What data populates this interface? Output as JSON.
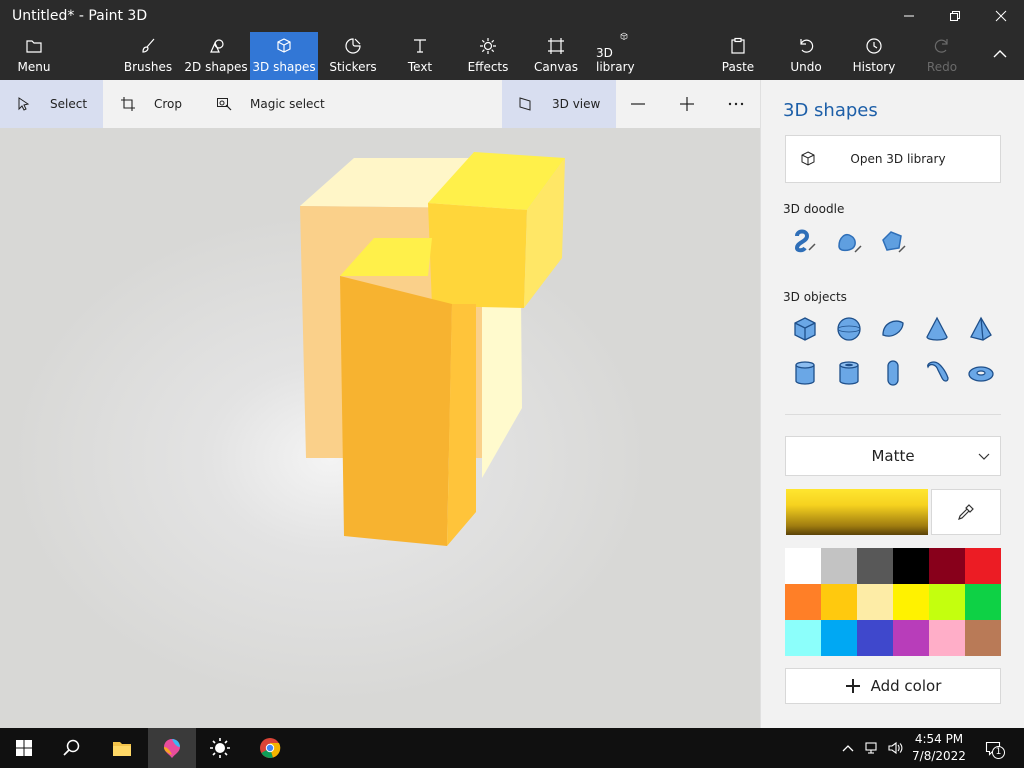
{
  "window": {
    "title": "Untitled* - Paint 3D"
  },
  "ribbon": {
    "menu": "Menu",
    "brushes": "Brushes",
    "shapes2d": "2D shapes",
    "shapes3d": "3D shapes",
    "stickers": "Stickers",
    "text": "Text",
    "effects": "Effects",
    "canvas": "Canvas",
    "library3d": "3D library",
    "paste": "Paste",
    "undo": "Undo",
    "history": "History",
    "redo": "Redo"
  },
  "toolbar": {
    "select": "Select",
    "crop": "Crop",
    "magic_select": "Magic select",
    "view3d": "3D view"
  },
  "panel": {
    "title": "3D shapes",
    "open_library": "Open 3D library",
    "doodle_label": "3D doodle",
    "objects_label": "3D objects",
    "finish": "Matte",
    "selected_color": "#f6d21f",
    "palette": [
      "#ffffff",
      "#c3c3c3",
      "#585858",
      "#000000",
      "#88001b",
      "#ec1c24",
      "#ff7f27",
      "#ffc90e",
      "#fdeca6",
      "#fff200",
      "#c4ff0e",
      "#0ed145",
      "#8cfffb",
      "#00a8f3",
      "#3f48cc",
      "#b83dba",
      "#ffaec8",
      "#b97a57"
    ],
    "add_color": "Add color"
  },
  "taskbar": {
    "time": "4:54 PM",
    "date": "7/8/2022",
    "notification_count": "1"
  }
}
